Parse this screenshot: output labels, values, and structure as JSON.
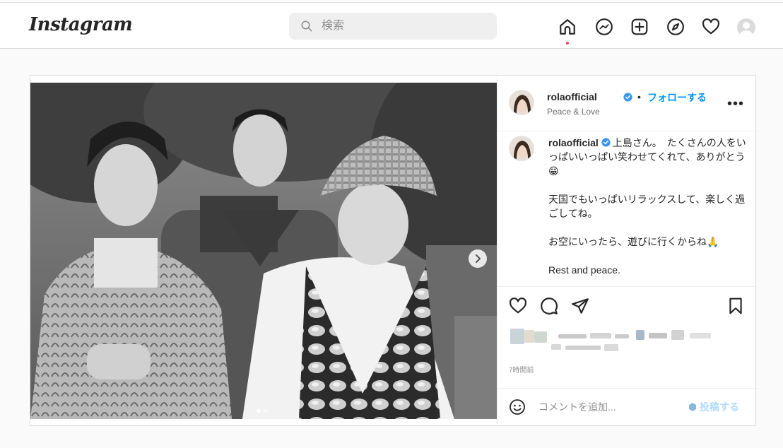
{
  "app": {
    "logo_text": "Instagram",
    "search_placeholder": "検索"
  },
  "nav": {
    "icons": [
      "home-icon",
      "messenger-icon",
      "new-post-icon",
      "explore-icon",
      "activity-heart-icon",
      "profile-avatar"
    ],
    "active": "home-icon",
    "accent_color": "#ed4956"
  },
  "post": {
    "author": "rolaofficial",
    "verified": true,
    "separator": "•",
    "follow_label": "フォローする",
    "location": "Peace & Love",
    "more_label": "•••",
    "caption": {
      "username": "rolaofficial",
      "lines": [
        "上島さん。　たくさんの人をいっぱいいっぱい笑わせてくれて、ありがとう😁",
        "天国でもいっぱいリラックスして、楽しく過ごしてね。",
        "お空にいったら、遊びに行くからね🙏",
        "Rest and peace."
      ]
    },
    "timestamp": "7時間前",
    "carousel": {
      "current": 1,
      "total": 2
    },
    "comment_placeholder": "コメントを追加...",
    "post_button_label": "投稿する",
    "colors": {
      "link_blue": "#0095f6",
      "disabled_blue": "#b3dbff",
      "verified_blue": "#3897f0"
    }
  }
}
